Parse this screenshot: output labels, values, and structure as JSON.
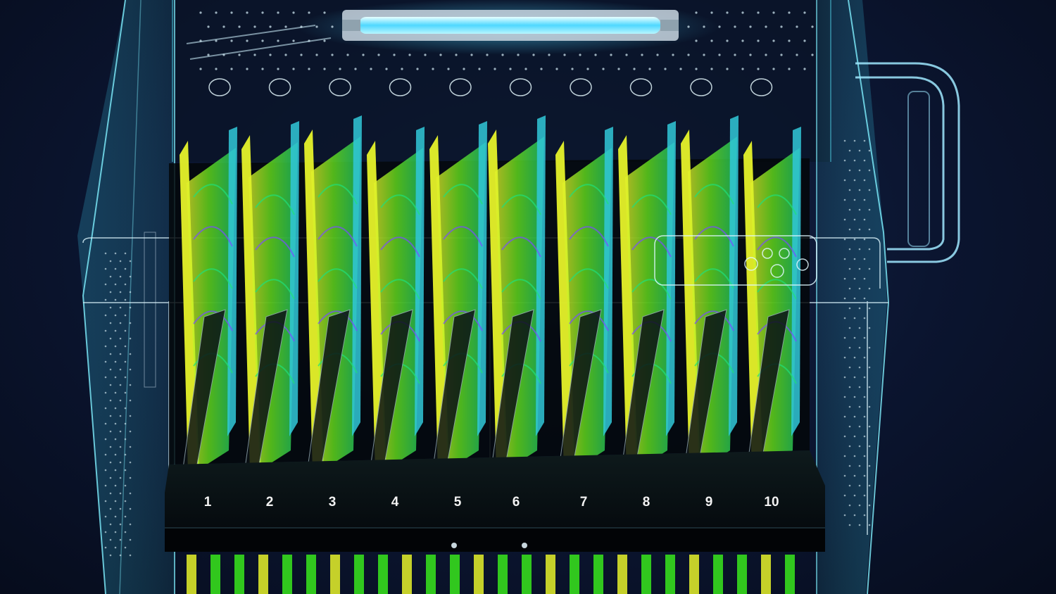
{
  "image": {
    "subject": "charging-cabinet",
    "colors": {
      "background": "#0b1530",
      "cabinet_edge": "#6fe6ff",
      "uv_lamp": "#4fd8ff",
      "device_yellow": "#e6f22a",
      "device_green": "#38e81c",
      "shelf": "#05080c"
    }
  },
  "slots": [
    "1",
    "2",
    "3",
    "4",
    "5",
    "6",
    "7",
    "8",
    "9",
    "10"
  ]
}
